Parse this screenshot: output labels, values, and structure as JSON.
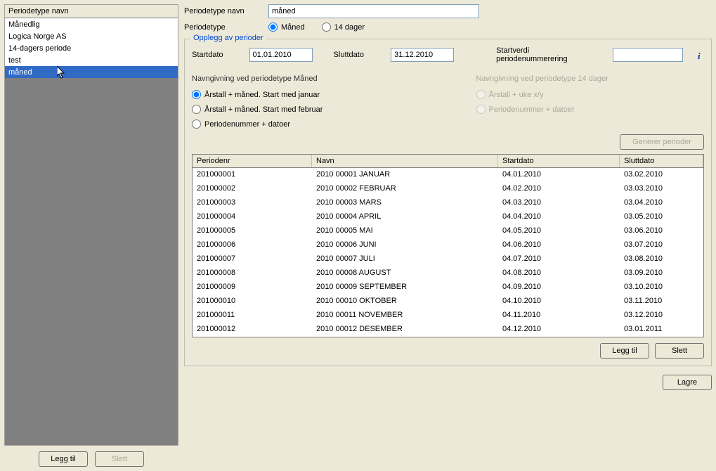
{
  "left": {
    "header": "Periodetype navn",
    "items": [
      "Månedlig",
      "Logica Norge AS",
      "14-dagers periode",
      "test",
      "måned"
    ],
    "selected_index": 4,
    "add_btn": "Legg til",
    "delete_btn": "Slett"
  },
  "form": {
    "name_label": "Periodetype navn",
    "name_value": "måned",
    "type_label": "Periodetype",
    "type_options": {
      "month": "Måned",
      "fourteen": "14 dager"
    }
  },
  "fieldset": {
    "legend": "Opplegg av perioder",
    "startdate_label": "Startdato",
    "startdate_value": "01.01.2010",
    "enddate_label": "Sluttdato",
    "enddate_value": "31.12.2010",
    "startnum_label": "Startverdi periodenummerering",
    "startnum_value": "",
    "naming_month_heading": "Navngivning ved periodetype Måned",
    "naming_month_options": {
      "jan": "Årstall + måned. Start med januar",
      "feb": "Årstall + måned. Start med februar",
      "num": "Periodenummer + datoer"
    },
    "naming_14_heading": "Navngivning ved periodetype 14 dager",
    "naming_14_options": {
      "week": "Årstall + uke x/y",
      "num": "Periodenummer + datoer"
    },
    "generate_btn": "Generer perioder"
  },
  "table": {
    "headers": [
      "Periodenr",
      "Navn",
      "Startdato",
      "Sluttdato"
    ],
    "rows": [
      [
        "201000001",
        "2010 00001 JANUAR",
        "04.01.2010",
        "03.02.2010"
      ],
      [
        "201000002",
        "2010 00002 FEBRUAR",
        "04.02.2010",
        "03.03.2010"
      ],
      [
        "201000003",
        "2010 00003 MARS",
        "04.03.2010",
        "03.04.2010"
      ],
      [
        "201000004",
        "2010 00004 APRIL",
        "04.04.2010",
        "03.05.2010"
      ],
      [
        "201000005",
        "2010 00005 MAI",
        "04.05.2010",
        "03.06.2010"
      ],
      [
        "201000006",
        "2010 00006 JUNI",
        "04.06.2010",
        "03.07.2010"
      ],
      [
        "201000007",
        "2010 00007 JULI",
        "04.07.2010",
        "03.08.2010"
      ],
      [
        "201000008",
        "2010 00008 AUGUST",
        "04.08.2010",
        "03.09.2010"
      ],
      [
        "201000009",
        "2010 00009 SEPTEMBER",
        "04.09.2010",
        "03.10.2010"
      ],
      [
        "201000010",
        "2010 00010 OKTOBER",
        "04.10.2010",
        "03.11.2010"
      ],
      [
        "201000011",
        "2010 00011 NOVEMBER",
        "04.11.2010",
        "03.12.2010"
      ],
      [
        "201000012",
        "2010 00012 DESEMBER",
        "04.12.2010",
        "03.01.2011"
      ]
    ]
  },
  "right_buttons": {
    "add": "Legg til",
    "delete": "Slett"
  },
  "footer": {
    "save": "Lagre"
  }
}
